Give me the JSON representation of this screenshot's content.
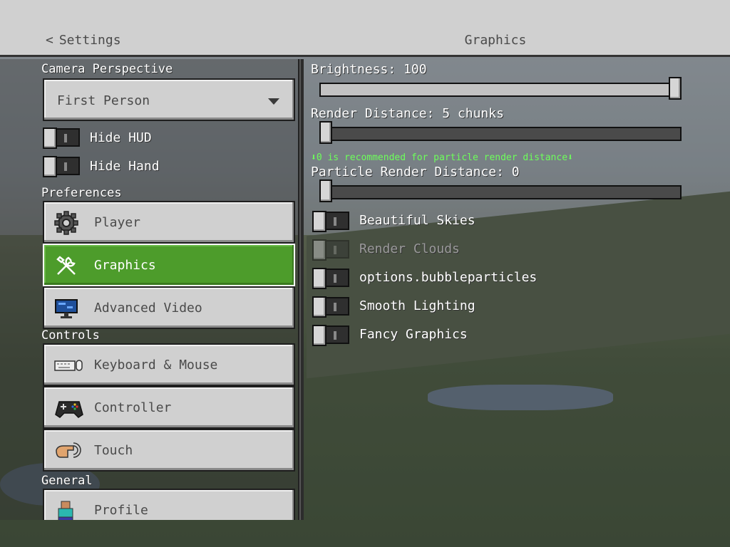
{
  "header": {
    "back_label": "Settings",
    "title": "Graphics"
  },
  "left": {
    "camera_section": "Camera Perspective",
    "camera_value": "First Person",
    "toggles": [
      {
        "label": "Hide HUD",
        "on": false
      },
      {
        "label": "Hide Hand",
        "on": false
      }
    ],
    "preferences_section": "Preferences",
    "preferences": [
      {
        "label": "Player",
        "icon": "gear-icon",
        "active": false
      },
      {
        "label": "Graphics",
        "icon": "wrench-screwdriver-icon",
        "active": true
      },
      {
        "label": "Advanced Video",
        "icon": "monitor-icon",
        "active": false
      }
    ],
    "controls_section": "Controls",
    "controls": [
      {
        "label": "Keyboard & Mouse",
        "icon": "keyboard-mouse-icon"
      },
      {
        "label": "Controller",
        "icon": "gamepad-icon"
      },
      {
        "label": "Touch",
        "icon": "touch-hand-icon"
      }
    ],
    "general_section": "General",
    "general": [
      {
        "label": "Profile",
        "icon": "profile-icon"
      }
    ]
  },
  "right": {
    "brightness_label": "Brightness: 100",
    "brightness_value": 1.0,
    "render_distance_label": "Render Distance: 5 chunks",
    "render_distance_value": 0.0,
    "hint": "⬇0 is recommended for particle render distance⬇",
    "particle_label": "Particle Render Distance: 0",
    "particle_value": 0.0,
    "toggles": [
      {
        "label": "Beautiful Skies",
        "on": false,
        "disabled": false
      },
      {
        "label": "Render Clouds",
        "on": false,
        "disabled": true
      },
      {
        "label": "options.bubbleparticles",
        "on": false,
        "disabled": false
      },
      {
        "label": "Smooth Lighting",
        "on": false,
        "disabled": false
      },
      {
        "label": "Fancy Graphics",
        "on": false,
        "disabled": false
      }
    ]
  },
  "colors": {
    "active_green": "#4d9c2b",
    "hint_green": "#6dff5a",
    "button_gray": "#d0d0d0"
  }
}
